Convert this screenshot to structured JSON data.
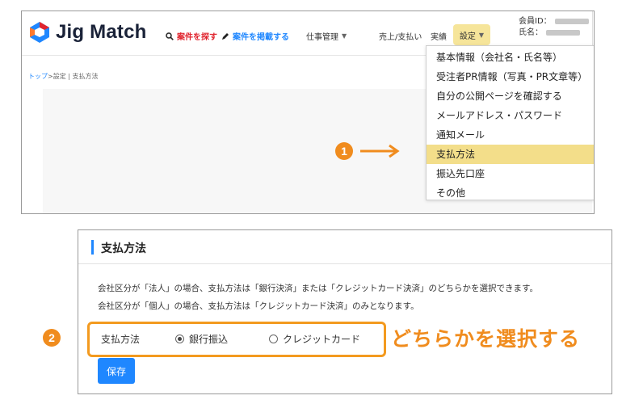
{
  "header": {
    "logo_text": "Jig Match",
    "nav": {
      "search": "案件を探す",
      "post": "案件を掲載する",
      "work": "仕事管理",
      "sales": "売上/支払い",
      "actual": "実績",
      "settings": "設定"
    },
    "member_id_label": "会員ID：",
    "member_name_label": "氏名："
  },
  "breadcrumb": {
    "home": "トップ",
    "rest": ">設定 | 支払方法"
  },
  "dropdown": {
    "items": [
      "基本情報（会社名・氏名等）",
      "受注者PR情報（写真・PR文章等）",
      "自分の公開ページを確認する",
      "メールアドレス・パスワード",
      "通知メール",
      "支払方法",
      "振込先口座",
      "その他"
    ],
    "selected_index": 5
  },
  "markers": {
    "step1": "1",
    "step2": "2"
  },
  "payment_panel": {
    "title": "支払方法",
    "desc1": "会社区分が「法人」の場合、支払方法は「銀行決済」または「クレジットカード決済」のどちらかを選択できます。",
    "desc2": "会社区分が「個人」の場合、支払方法は「クレジットカード決済」のみとなります。",
    "field_label": "支払方法",
    "options": [
      "銀行振込",
      "クレジットカード"
    ],
    "selected_option": "銀行振込",
    "save_label": "保存"
  },
  "callout": "どちらかを選択する",
  "colors": {
    "accent_blue": "#1f87ff",
    "accent_orange": "#f08c1e",
    "highlight_yellow": "#f3de8a",
    "search_red": "#e0242e"
  }
}
